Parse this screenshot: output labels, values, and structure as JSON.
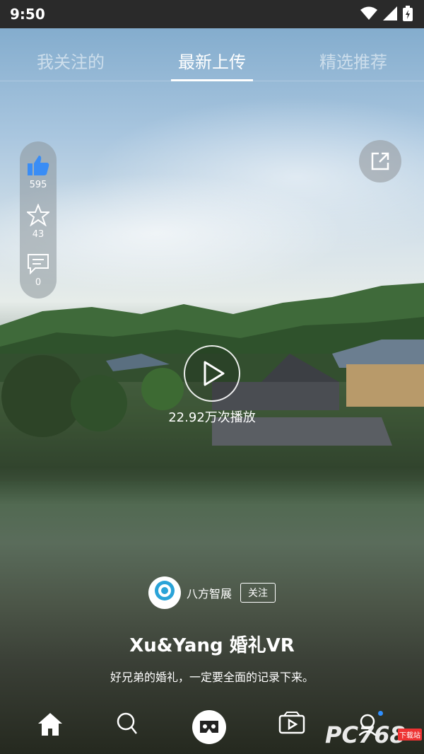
{
  "status_bar": {
    "time": "9:50"
  },
  "tabs": [
    {
      "label": "我关注的",
      "active": false
    },
    {
      "label": "最新上传",
      "active": true
    },
    {
      "label": "精选推荐",
      "active": false
    }
  ],
  "actions": {
    "likes": "595",
    "favorites": "43",
    "comments": "0"
  },
  "video": {
    "play_count": "22.92万次播放",
    "title": "Xu&Yang 婚礼VR",
    "description": "好兄弟的婚礼，一定要全面的记录下来。"
  },
  "author": {
    "name": "八方智展",
    "follow_label": "关注"
  },
  "nav": {
    "items": [
      "home-icon",
      "search-icon",
      "vr-glasses-icon",
      "video-icon",
      "profile-icon"
    ]
  },
  "watermark": {
    "text": "PC768",
    "badge": "下载站"
  },
  "colors": {
    "like_active": "#3a8df5",
    "accent_dot": "#2f8fff"
  }
}
